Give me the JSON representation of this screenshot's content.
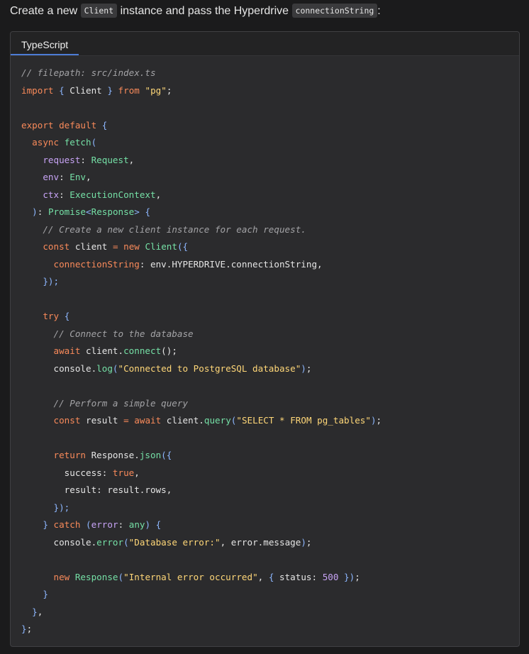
{
  "intro": {
    "prefix": "Create a new ",
    "code1": "Client",
    "middle": " instance and pass the Hyperdrive ",
    "code2": "connectionString",
    "suffix": ":"
  },
  "codeblock": {
    "language_tab": "TypeScript",
    "lines": [
      [
        [
          "comment",
          "// filepath: src/index.ts"
        ]
      ],
      [
        [
          "keyword",
          "import"
        ],
        [
          "text",
          " "
        ],
        [
          "punct",
          "{"
        ],
        [
          "text",
          " Client "
        ],
        [
          "punct",
          "}"
        ],
        [
          "text",
          " "
        ],
        [
          "keyword",
          "from"
        ],
        [
          "text",
          " "
        ],
        [
          "string",
          "\"pg\""
        ],
        [
          "text",
          ";"
        ]
      ],
      [],
      [
        [
          "keyword",
          "export default"
        ],
        [
          "text",
          " "
        ],
        [
          "punct",
          "{"
        ]
      ],
      [
        [
          "text",
          "  "
        ],
        [
          "keyword",
          "async"
        ],
        [
          "text",
          " "
        ],
        [
          "func",
          "fetch"
        ],
        [
          "punct",
          "("
        ]
      ],
      [
        [
          "text",
          "    "
        ],
        [
          "prop",
          "request"
        ],
        [
          "text",
          ": "
        ],
        [
          "type",
          "Request"
        ],
        [
          "text",
          ","
        ]
      ],
      [
        [
          "text",
          "    "
        ],
        [
          "prop",
          "env"
        ],
        [
          "text",
          ": "
        ],
        [
          "type",
          "Env"
        ],
        [
          "text",
          ","
        ]
      ],
      [
        [
          "text",
          "    "
        ],
        [
          "prop",
          "ctx"
        ],
        [
          "text",
          ": "
        ],
        [
          "type",
          "ExecutionContext"
        ],
        [
          "text",
          ","
        ]
      ],
      [
        [
          "text",
          "  "
        ],
        [
          "punct",
          ")"
        ],
        [
          "text",
          ": "
        ],
        [
          "type",
          "Promise"
        ],
        [
          "punct",
          "<"
        ],
        [
          "type",
          "Response"
        ],
        [
          "punct",
          ">"
        ],
        [
          "text",
          " "
        ],
        [
          "punct",
          "{"
        ]
      ],
      [
        [
          "text",
          "    "
        ],
        [
          "comment",
          "// Create a new client instance for each request."
        ]
      ],
      [
        [
          "text",
          "    "
        ],
        [
          "keyword",
          "const"
        ],
        [
          "text",
          " client "
        ],
        [
          "keyword",
          "="
        ],
        [
          "text",
          " "
        ],
        [
          "keyword",
          "new"
        ],
        [
          "text",
          " "
        ],
        [
          "type",
          "Client"
        ],
        [
          "punct",
          "({"
        ]
      ],
      [
        [
          "text",
          "      "
        ],
        [
          "key",
          "connectionString"
        ],
        [
          "text",
          ": env.HYPERDRIVE.connectionString,"
        ]
      ],
      [
        [
          "text",
          "    "
        ],
        [
          "punct",
          "});"
        ]
      ],
      [],
      [
        [
          "text",
          "    "
        ],
        [
          "keyword",
          "try"
        ],
        [
          "text",
          " "
        ],
        [
          "punct",
          "{"
        ]
      ],
      [
        [
          "text",
          "      "
        ],
        [
          "comment",
          "// Connect to the database"
        ]
      ],
      [
        [
          "text",
          "      "
        ],
        [
          "keyword",
          "await"
        ],
        [
          "text",
          " client."
        ],
        [
          "func",
          "connect"
        ],
        [
          "text",
          "();"
        ]
      ],
      [
        [
          "text",
          "      console."
        ],
        [
          "func",
          "log"
        ],
        [
          "punct",
          "("
        ],
        [
          "string",
          "\"Connected to PostgreSQL database\""
        ],
        [
          "punct",
          ")"
        ],
        [
          "text",
          ";"
        ]
      ],
      [],
      [
        [
          "text",
          "      "
        ],
        [
          "comment",
          "// Perform a simple query"
        ]
      ],
      [
        [
          "text",
          "      "
        ],
        [
          "keyword",
          "const"
        ],
        [
          "text",
          " result "
        ],
        [
          "keyword",
          "="
        ],
        [
          "text",
          " "
        ],
        [
          "keyword",
          "await"
        ],
        [
          "text",
          " client."
        ],
        [
          "func",
          "query"
        ],
        [
          "punct",
          "("
        ],
        [
          "string",
          "\"SELECT * FROM pg_tables\""
        ],
        [
          "punct",
          ")"
        ],
        [
          "text",
          ";"
        ]
      ],
      [],
      [
        [
          "text",
          "      "
        ],
        [
          "keyword",
          "return"
        ],
        [
          "text",
          " Response."
        ],
        [
          "func",
          "json"
        ],
        [
          "punct",
          "({"
        ]
      ],
      [
        [
          "text",
          "        success: "
        ],
        [
          "bool",
          "true"
        ],
        [
          "text",
          ","
        ]
      ],
      [
        [
          "text",
          "        result: result.rows,"
        ]
      ],
      [
        [
          "text",
          "      "
        ],
        [
          "punct",
          "});"
        ]
      ],
      [
        [
          "text",
          "    "
        ],
        [
          "punct",
          "}"
        ],
        [
          "text",
          " "
        ],
        [
          "keyword",
          "catch"
        ],
        [
          "text",
          " "
        ],
        [
          "punct",
          "("
        ],
        [
          "prop",
          "error"
        ],
        [
          "text",
          ": "
        ],
        [
          "type",
          "any"
        ],
        [
          "punct",
          ")"
        ],
        [
          "text",
          " "
        ],
        [
          "punct",
          "{"
        ]
      ],
      [
        [
          "text",
          "      console."
        ],
        [
          "func",
          "error"
        ],
        [
          "punct",
          "("
        ],
        [
          "string",
          "\"Database error:\""
        ],
        [
          "text",
          ", error.message"
        ],
        [
          "punct",
          ")"
        ],
        [
          "text",
          ";"
        ]
      ],
      [],
      [
        [
          "text",
          "      "
        ],
        [
          "keyword",
          "new"
        ],
        [
          "text",
          " "
        ],
        [
          "type",
          "Response"
        ],
        [
          "punct",
          "("
        ],
        [
          "string",
          "\"Internal error occurred\""
        ],
        [
          "text",
          ", "
        ],
        [
          "punct",
          "{"
        ],
        [
          "text",
          " status: "
        ],
        [
          "number",
          "500"
        ],
        [
          "text",
          " "
        ],
        [
          "punct",
          "}"
        ],
        [
          "punct",
          ")"
        ],
        [
          "text",
          ";"
        ]
      ],
      [
        [
          "text",
          "    "
        ],
        [
          "punct",
          "}"
        ]
      ],
      [
        [
          "text",
          "  "
        ],
        [
          "punct",
          "}"
        ],
        [
          "text",
          ","
        ]
      ],
      [
        [
          "punct",
          "}"
        ],
        [
          "text",
          ";"
        ]
      ]
    ]
  }
}
